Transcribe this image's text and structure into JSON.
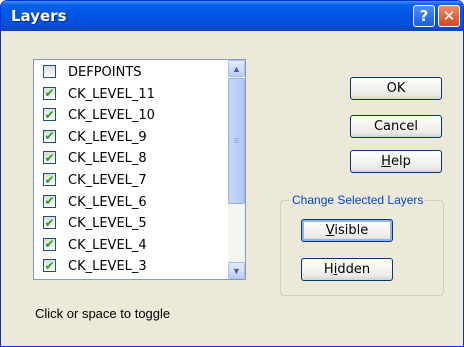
{
  "window": {
    "title": "Layers",
    "help_glyph": "?",
    "close_glyph": "✕"
  },
  "layers": {
    "items": [
      {
        "name": "DEFPOINTS",
        "checked": false
      },
      {
        "name": "CK_LEVEL_11",
        "checked": true
      },
      {
        "name": "CK_LEVEL_10",
        "checked": true
      },
      {
        "name": "CK_LEVEL_9",
        "checked": true
      },
      {
        "name": "CK_LEVEL_8",
        "checked": true
      },
      {
        "name": "CK_LEVEL_7",
        "checked": true
      },
      {
        "name": "CK_LEVEL_6",
        "checked": true
      },
      {
        "name": "CK_LEVEL_5",
        "checked": true
      },
      {
        "name": "CK_LEVEL_4",
        "checked": true
      },
      {
        "name": "CK_LEVEL_3",
        "checked": true
      }
    ],
    "check_glyph": "✔"
  },
  "buttons": {
    "ok": "OK",
    "cancel": "Cancel",
    "help": "Help",
    "visible": "Visible",
    "hidden": "Hidden"
  },
  "group": {
    "label": "Change Selected Layers"
  },
  "status": "Click or space to toggle",
  "colors": {
    "titlebar": "#0055e5",
    "dialog_bg": "#ece9d8",
    "group_label": "#0046d5",
    "check_mark": "#21a121"
  }
}
